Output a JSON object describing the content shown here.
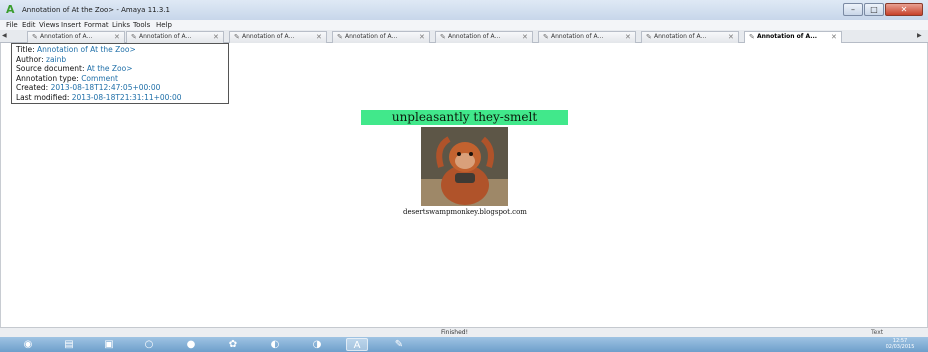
{
  "window": {
    "title": "Annotation of At the Zoo> - Amaya 11.3.1",
    "minimize_label": "–",
    "maximize_label": "□",
    "close_label": "✕"
  },
  "menu": [
    "File",
    "Edit",
    "Views",
    "Insert",
    "Format",
    "Links",
    "Tools",
    "Help"
  ],
  "tabs": [
    {
      "label": "Annotation of A...",
      "active": false
    },
    {
      "label": "Annotation of A...",
      "active": false
    },
    {
      "label": "Annotation of A...",
      "active": false
    },
    {
      "label": "Annotation of A...",
      "active": false
    },
    {
      "label": "Annotation of A...",
      "active": false
    },
    {
      "label": "Annotation of A...",
      "active": false
    },
    {
      "label": "Annotation of A...",
      "active": false
    },
    {
      "label": "Annotation of A...",
      "active": true
    }
  ],
  "tab_close_glyph": "✕",
  "tab_scroll_left": "◀",
  "tab_scroll_right": "▶",
  "annotation": {
    "title_label": "Title:",
    "title_value": "Annotation of At the Zoo>",
    "author_label": "Author:",
    "author_value": "zainb",
    "source_label": "Source document:",
    "source_value": "At the Zoo>",
    "type_label": "Annotation type:",
    "type_value": "Comment",
    "created_label": "Created:",
    "created_value": "2013-08-18T12:47:05+00:00",
    "modified_label": "Last modified:",
    "modified_value": "2013-08-18T21:31:11+00:00"
  },
  "document": {
    "headline": "unpleasantly they-smelt",
    "highlight_color": "#41e88b",
    "image_icon": "monkey-photo",
    "caption": "desertswampmonkey.blogspot.com"
  },
  "status": {
    "text": "Finished!",
    "mode": "Text"
  },
  "taskbar": {
    "clock_time": "12:57",
    "clock_date": "02/03/2015"
  }
}
